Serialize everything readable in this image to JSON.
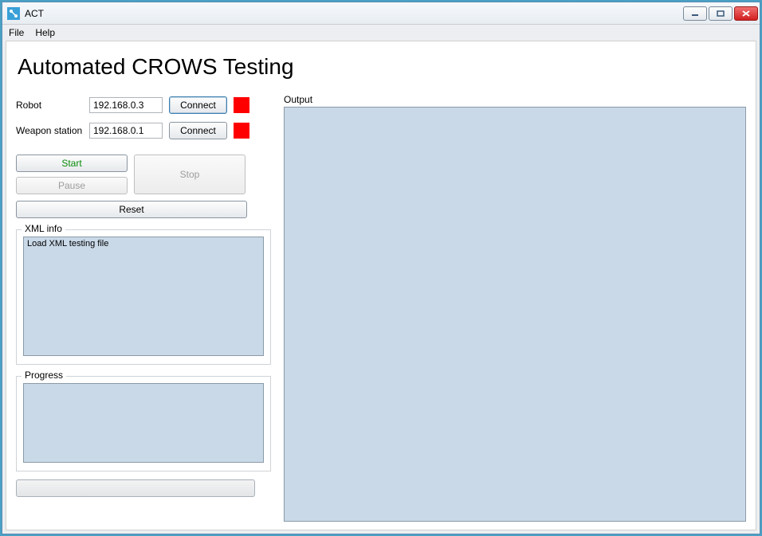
{
  "window": {
    "title": "ACT"
  },
  "menu": {
    "file": "File",
    "help": "Help"
  },
  "heading": "Automated CROWS Testing",
  "connections": {
    "robot": {
      "label": "Robot",
      "ip": "192.168.0.3",
      "button": "Connect",
      "status_color": "#fe0000"
    },
    "weapon": {
      "label": "Weapon station",
      "ip": "192.168.0.1",
      "button": "Connect",
      "status_color": "#fe0000"
    }
  },
  "controls": {
    "start": "Start",
    "pause": "Pause",
    "stop": "Stop",
    "reset": "Reset"
  },
  "xml": {
    "group_label": "XML info",
    "content": "Load XML testing file"
  },
  "progress": {
    "group_label": "Progress",
    "content": ""
  },
  "output": {
    "label": "Output"
  }
}
